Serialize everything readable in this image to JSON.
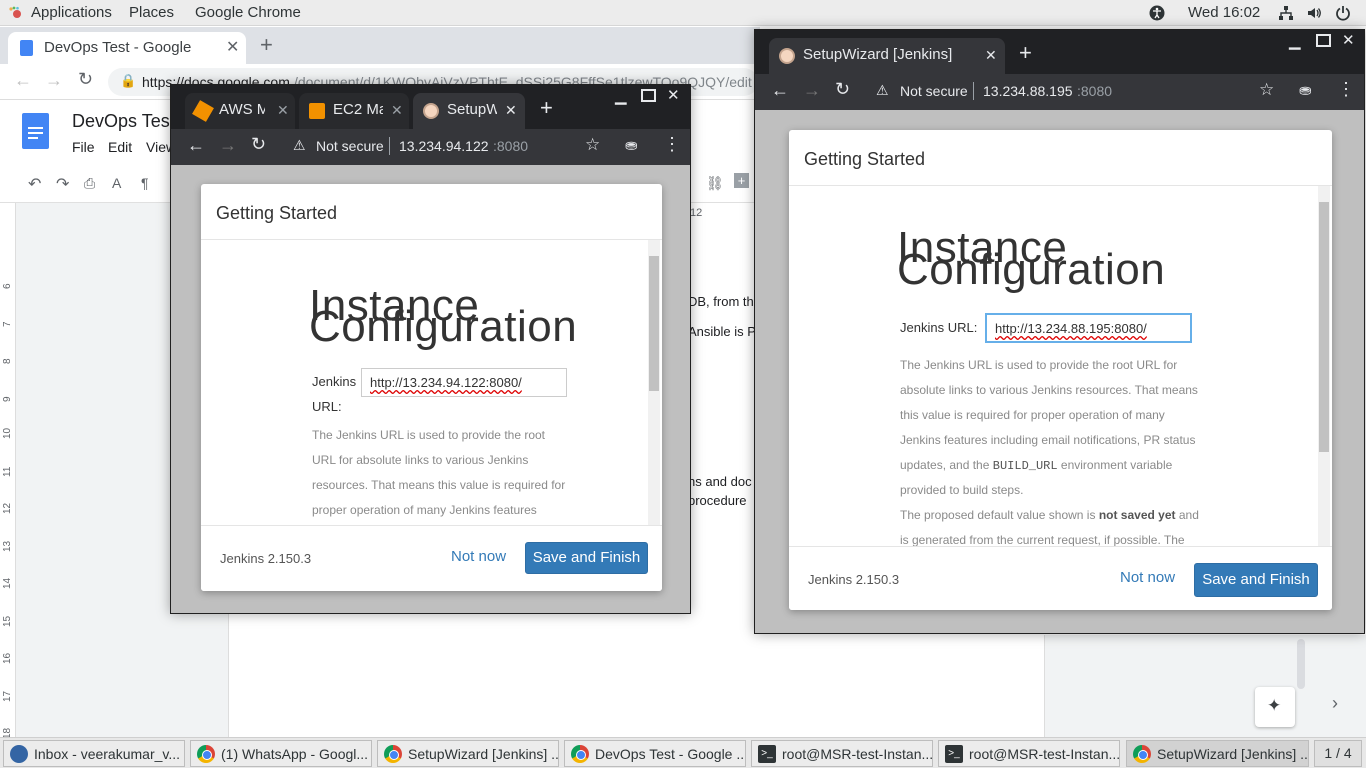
{
  "topbar": {
    "applications": "Applications",
    "places": "Places",
    "active_app": "Google Chrome",
    "clock": "Wed 16:02"
  },
  "bg_window": {
    "tab_title": "DevOps Test - Google Do",
    "url_host": "https://docs.google.com",
    "url_path": "/document/d/1KWObvAiVzVPThtE_dSSi25G8FffSe1tlzewTOo9QJQY/edit",
    "doc_title": "DevOps Test",
    "menu": [
      "File",
      "Edit",
      "View"
    ],
    "ruler_marks": [
      "6",
      "7",
      "8",
      "9",
      "10",
      "11",
      "12",
      "13",
      "14",
      "15",
      "16",
      "17",
      "18"
    ],
    "top_ruler_label": "12",
    "body_snippets": [
      "DB, from th",
      "Ansible is P",
      "ns and doc",
      "procedure"
    ]
  },
  "win1": {
    "tabs": [
      "AWS M",
      "EC2 Ma",
      "SetupW"
    ],
    "security": "Not secure",
    "url_host": "13.234.94.122",
    "url_port": ":8080",
    "dialog": {
      "title": "Getting Started",
      "heading_line1": "Instance",
      "heading_line2": "Configuration",
      "label_line1": "Jenkins",
      "label_line2": "URL:",
      "url_value": "http://13.234.94.122:8080/",
      "help": [
        "The Jenkins URL is used to provide the root",
        "URL for absolute links to various Jenkins",
        "resources. That means this value is required for",
        "proper operation of many Jenkins features"
      ],
      "version": "Jenkins 2.150.3",
      "not_now": "Not now",
      "save": "Save and Finish"
    }
  },
  "win2": {
    "tab_title": "SetupWizard [Jenkins]",
    "security": "Not secure",
    "url_host": "13.234.88.195",
    "url_port": ":8080",
    "dialog": {
      "title": "Getting Started",
      "heading_line1": "Instance",
      "heading_line2": "Configuration",
      "label": "Jenkins URL:",
      "url_value": "http://13.234.88.195:8080/",
      "help": [
        "The Jenkins URL is used to provide the root URL for",
        "absolute links to various Jenkins resources. That means",
        "this value is required for proper operation of many",
        "Jenkins features including email notifications, PR status",
        "updates, and the",
        "environment variable",
        "provided to build steps.",
        "The proposed default value shown is",
        "not saved yet",
        "and",
        "is generated from the current request, if possible. The"
      ],
      "build_url_code": "BUILD_URL",
      "version": "Jenkins 2.150.3",
      "not_now": "Not now",
      "save": "Save and Finish"
    }
  },
  "taskbar": {
    "items": [
      "Inbox - veerakumar_v...",
      "(1) WhatsApp - Googl...",
      "SetupWizard [Jenkins] ...",
      "DevOps Test - Google ...",
      "root@MSR-test-Instan...",
      "root@MSR-test-Instan...",
      "SetupWizard [Jenkins] ..."
    ],
    "workspace": "1 / 4"
  }
}
